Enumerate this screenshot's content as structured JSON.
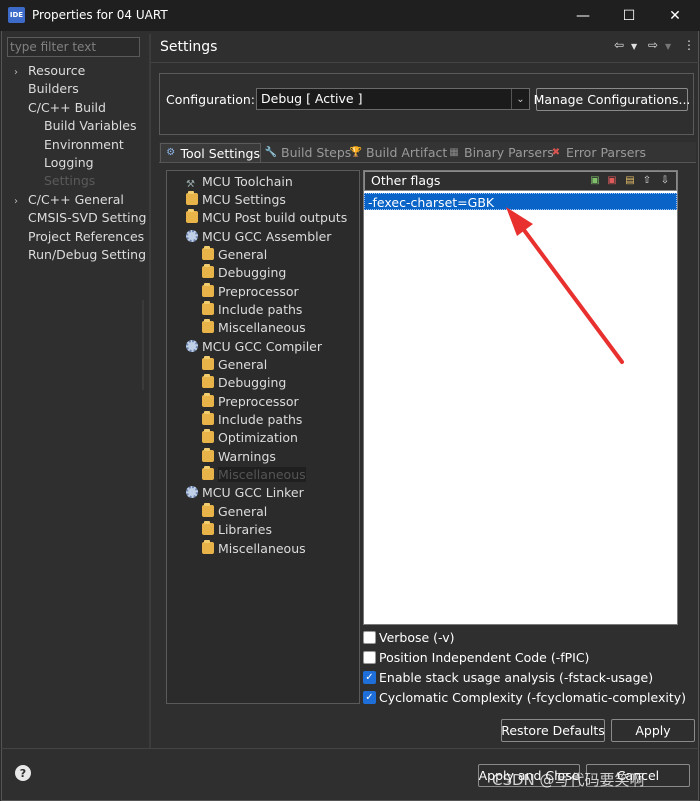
{
  "window": {
    "title": "Properties for 04 UART",
    "app_icon": "IDE",
    "controls": {
      "minimize": "—",
      "maximize": "☐",
      "close": "✕"
    }
  },
  "filter": {
    "placeholder": "type filter text"
  },
  "left_tree": [
    {
      "label": "Resource",
      "expandable": true,
      "indent": 0
    },
    {
      "label": "Builders",
      "expandable": false,
      "indent": 0
    },
    {
      "label": "C/C++ Build",
      "expandable": false,
      "expanded": true,
      "indent": 0
    },
    {
      "label": "Build Variables",
      "expandable": false,
      "indent": 1
    },
    {
      "label": "Environment",
      "expandable": false,
      "indent": 1
    },
    {
      "label": "Logging",
      "expandable": false,
      "indent": 1
    },
    {
      "label": "Settings",
      "expandable": false,
      "indent": 1,
      "selected": true
    },
    {
      "label": "C/C++ General",
      "expandable": true,
      "indent": 0
    },
    {
      "label": "CMSIS-SVD Setting",
      "expandable": false,
      "indent": 0
    },
    {
      "label": "Project References",
      "expandable": false,
      "indent": 0
    },
    {
      "label": "Run/Debug Setting",
      "expandable": false,
      "indent": 0
    }
  ],
  "header": {
    "title": "Settings"
  },
  "configuration": {
    "label": "Configuration:",
    "value": "Debug  [ Active ]",
    "manage_label": "Manage Configurations..."
  },
  "tabs": [
    {
      "label": "Tool Settings",
      "icon": "tool-settings-icon",
      "active": true
    },
    {
      "label": "Build Steps",
      "icon": "build-steps-icon"
    },
    {
      "label": "Build Artifact",
      "icon": "build-artifact-icon"
    },
    {
      "label": "Binary Parsers",
      "icon": "binary-parsers-icon"
    },
    {
      "label": "Error Parsers",
      "icon": "error-parsers-icon"
    }
  ],
  "tool_tree": [
    {
      "label": "MCU Toolchain",
      "icon": "wrench",
      "indent": 1
    },
    {
      "label": "MCU Settings",
      "icon": "folder",
      "indent": 1
    },
    {
      "label": "MCU Post build outputs",
      "icon": "folder",
      "indent": 1
    },
    {
      "label": "MCU GCC Assembler",
      "icon": "gear",
      "indent": 1
    },
    {
      "label": "General",
      "icon": "folder",
      "indent": 2
    },
    {
      "label": "Debugging",
      "icon": "folder",
      "indent": 2
    },
    {
      "label": "Preprocessor",
      "icon": "folder",
      "indent": 2
    },
    {
      "label": "Include paths",
      "icon": "folder",
      "indent": 2
    },
    {
      "label": "Miscellaneous",
      "icon": "folder",
      "indent": 2
    },
    {
      "label": "MCU GCC Compiler",
      "icon": "gear",
      "indent": 1
    },
    {
      "label": "General",
      "icon": "folder",
      "indent": 2
    },
    {
      "label": "Debugging",
      "icon": "folder",
      "indent": 2
    },
    {
      "label": "Preprocessor",
      "icon": "folder",
      "indent": 2
    },
    {
      "label": "Include paths",
      "icon": "folder",
      "indent": 2
    },
    {
      "label": "Optimization",
      "icon": "folder",
      "indent": 2
    },
    {
      "label": "Warnings",
      "icon": "folder",
      "indent": 2
    },
    {
      "label": "Miscellaneous",
      "icon": "folder",
      "indent": 2,
      "selected": true
    },
    {
      "label": "MCU GCC Linker",
      "icon": "gear",
      "indent": 1
    },
    {
      "label": "General",
      "icon": "folder",
      "indent": 2
    },
    {
      "label": "Libraries",
      "icon": "folder",
      "indent": 2
    },
    {
      "label": "Miscellaneous",
      "icon": "folder",
      "indent": 2
    }
  ],
  "flags": {
    "header": "Other flags",
    "items": [
      "-fexec-charset=GBK"
    ]
  },
  "options": [
    {
      "label": "Verbose (-v)",
      "checked": false
    },
    {
      "label": "Position Independent Code (-fPIC)",
      "checked": false
    },
    {
      "label": "Enable stack usage analysis (-fstack-usage)",
      "checked": true
    },
    {
      "label": "Cyclomatic Complexity (-fcyclomatic-complexity)",
      "checked": true
    }
  ],
  "buttons": {
    "restore_defaults": "Restore Defaults",
    "apply": "Apply",
    "apply_and_close": "Apply and Close",
    "cancel": "Cancel"
  },
  "watermark": "CSDN @写代码要笑啊",
  "colors": {
    "selection": "#0a64c8",
    "annotation_arrow": "#e8312f"
  }
}
